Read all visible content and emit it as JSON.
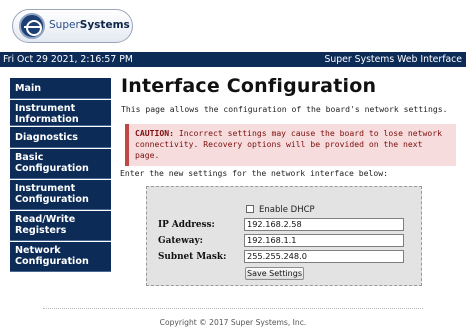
{
  "brand": {
    "logo_text_light": "Super",
    "logo_text_bold": "Systems"
  },
  "topbar": {
    "datetime": "Fri Oct 29 2021, 2:16:57 PM",
    "site_name": "Super Systems Web Interface"
  },
  "sidebar": {
    "items": [
      {
        "label": "Main"
      },
      {
        "label": "Instrument Information"
      },
      {
        "label": "Diagnostics"
      },
      {
        "label": "Basic Configuration"
      },
      {
        "label": "Instrument Configuration"
      },
      {
        "label": "Read/Write Registers"
      },
      {
        "label": "Network Configuration"
      }
    ]
  },
  "main": {
    "title": "Interface Configuration",
    "intro": "This page allows the configuration of the board's network settings.",
    "caution_label": "CAUTION:",
    "caution_text": " Incorrect settings may cause the board to lose network connectivity. Recovery options will be provided on the next page.",
    "enter_text": "Enter the new settings for the network interface below:"
  },
  "form": {
    "dhcp_label": "Enable DHCP",
    "dhcp_checked": false,
    "ip_label": "IP Address:",
    "ip_value": "192.168.2.58",
    "gateway_label": "Gateway:",
    "gateway_value": "192.168.1.1",
    "subnet_label": "Subnet Mask:",
    "subnet_value": "255.255.248.0",
    "save_label": "Save Settings"
  },
  "footer": {
    "copyright": "Copyright © 2017 Super Systems, Inc."
  },
  "colors": {
    "nav_background": "#0c2b57",
    "caution_background": "#f6dcdc",
    "caution_text": "#7c0f0f",
    "form_background": "#e3e3e3"
  },
  "icons": {
    "logo": "super-systems-logo-icon",
    "dhcp_checkbox": "checkbox-icon"
  }
}
